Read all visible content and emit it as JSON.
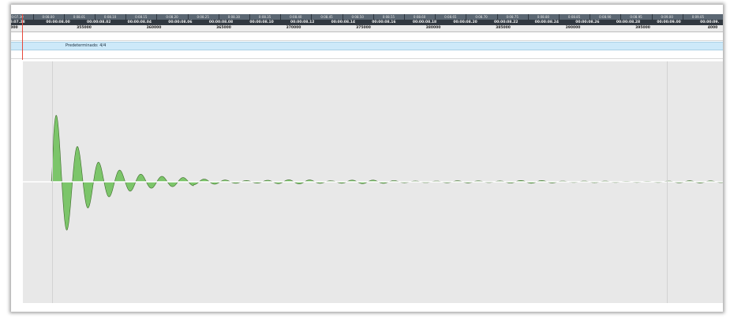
{
  "ruler": {
    "bars": [
      "0:07.30",
      "0:08.00",
      "0:08.01",
      "0:08.10",
      "0:08.15",
      "0:08.20",
      "0:08.25",
      "0:08.30",
      "0:08.35",
      "0:08.40",
      "0:08.45",
      "0:08.50",
      "0:08.55",
      "0:08.60",
      "0:08.65",
      "0:08.70",
      "0:08.75",
      "0:08.80",
      "0:08.85",
      "0:08.90",
      "0:08.95",
      "0:09.00",
      "0:09.05"
    ],
    "timecodes": [
      "0:07.28",
      "00:00:08.00",
      "00:00:08.02",
      "00:00:08.04",
      "00:00:08.06",
      "00:00:08.08",
      "00:00:08.10",
      "00:00:08.12",
      "00:00:08.14",
      "00:00:08.16",
      "00:00:08.18",
      "00:00:08.20",
      "00:00:08.22",
      "00:00:08.24",
      "00:00:08.26",
      "00:00:08.28",
      "00:00:09.00",
      "00:00:09."
    ],
    "samples": [
      "000",
      "355000",
      "360000",
      "365000",
      "370000",
      "375000",
      "380000",
      "385000",
      "390000",
      "395000",
      "4000"
    ]
  },
  "signature_track": {
    "label": "Predeterminado: 4/4"
  },
  "waveform": {
    "color": "#7cc56a",
    "stroke": "#3d6b2a",
    "center_line": "#ffffff"
  }
}
